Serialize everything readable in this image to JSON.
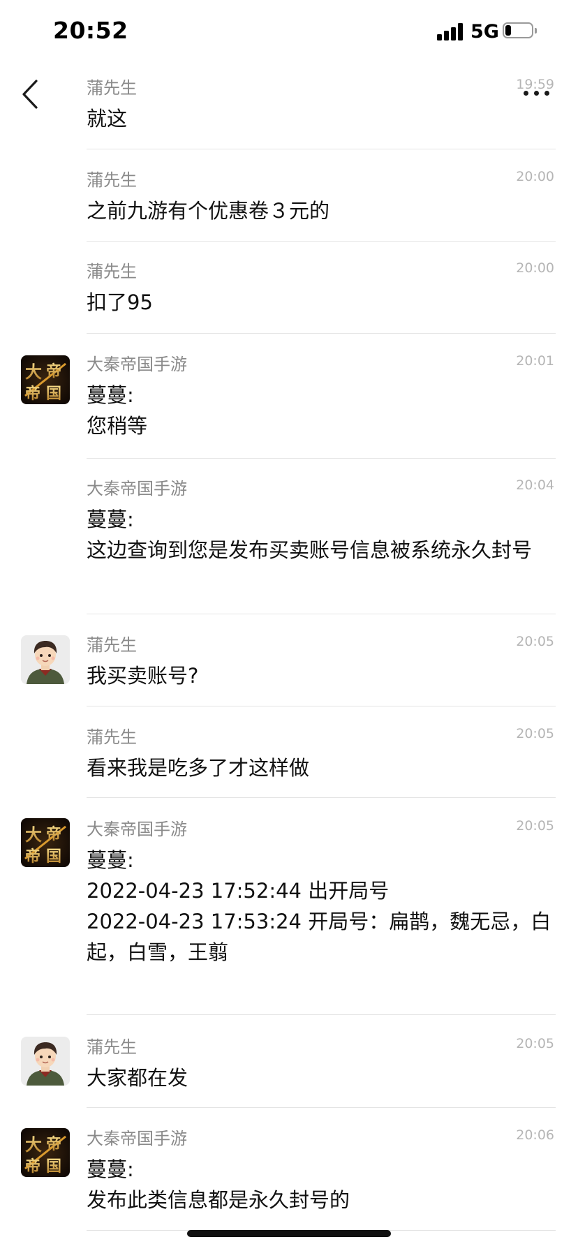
{
  "status_bar": {
    "time": "20:52",
    "network": "5G",
    "battery_level": 0.22,
    "signal_icon": "signal-bars-icon",
    "battery_icon": "battery-icon"
  },
  "header": {
    "back_icon": "chevron-left-icon",
    "more_icon": "more-dots-icon"
  },
  "messages": [
    {
      "sender": "蒲先生",
      "time": "19:59",
      "text": "就这"
    },
    {
      "sender": "蒲先生",
      "time": "20:00",
      "text": "之前九游有个优惠卷３元的"
    },
    {
      "sender": "蒲先生",
      "time": "20:00",
      "text": "扣了95"
    },
    {
      "sender": "大秦帝国手游",
      "time": "20:01",
      "text": "蔓蔓:\n您稍等",
      "avatar": "game-logo-avatar"
    },
    {
      "sender": "大秦帝国手游",
      "time": "20:04",
      "text": "蔓蔓:\n这边查询到您是发布买卖账号信息被系统永久封号"
    },
    {
      "sender": "蒲先生",
      "time": "20:05",
      "text": "我买卖账号?",
      "avatar": "user-avatar"
    },
    {
      "sender": "蒲先生",
      "time": "20:05",
      "text": "看来我是吃多了才这样做"
    },
    {
      "sender": "大秦帝国手游",
      "time": "20:05",
      "text": "蔓蔓:\n2022-04-23 17:52:44   出开局号\n2022-04-23 17:53:24   开局号：扁鹊，魏无忌，白起，白雪，王翦",
      "avatar": "game-logo-avatar"
    },
    {
      "sender": "蒲先生",
      "time": "20:05",
      "text": "大家都在发",
      "avatar": "user-avatar"
    },
    {
      "sender": "大秦帝国手游",
      "time": "20:06",
      "text": "蔓蔓:\n发布此类信息都是永久封号的",
      "avatar": "game-logo-avatar"
    }
  ],
  "colors": {
    "background": "#ffffff",
    "sender": "#8a8a8a",
    "timestamp": "#b5b5b5",
    "divider": "#e4e4e4",
    "text": "#111111"
  }
}
